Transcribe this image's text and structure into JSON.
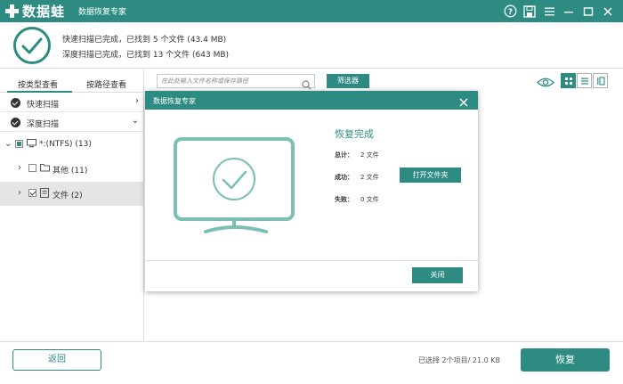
{
  "app": {
    "logo_text": "数据蛙",
    "title": "数据恢复专家"
  },
  "window_icons": [
    "help-icon",
    "save-icon",
    "menu-icon",
    "minimize-icon",
    "maximize-icon",
    "close-icon"
  ],
  "scan_summary": {
    "quick_line": "快速扫描已完成，已找到 5 个文件 (43.4 MB)",
    "deep_line": "深度扫描已完成，已找到 13 个文件 (643 MB)"
  },
  "sidebar": {
    "tabs": [
      {
        "label": "按类型查看",
        "active": true
      },
      {
        "label": "按路径查看",
        "active": false
      }
    ],
    "scan_modes": [
      {
        "label": "快速扫描",
        "arrow": "›"
      },
      {
        "label": "深度扫描",
        "arrow": "⌄"
      }
    ],
    "tree": [
      {
        "expander": "⌄",
        "label": "*:(NTFS) (13)",
        "checkbox": "partial"
      },
      {
        "expander": "›",
        "label": "其他 (11)",
        "checkbox": "unchecked"
      },
      {
        "expander": "›",
        "label": "文件 (2)",
        "checkbox": "checked"
      }
    ]
  },
  "toolbar": {
    "search_placeholder": "在此处输入文件名称或保存路径",
    "filter_label": "筛选器"
  },
  "footer": {
    "back_label": "返回",
    "selection_info": "已选择 2个项目/ 21.0 KB",
    "recover_label": "恢复"
  },
  "dialog": {
    "title": "数据恢复专家",
    "heading": "恢复完成",
    "stats": [
      {
        "label": "总计：",
        "value": "2 文件"
      },
      {
        "label": "成功：",
        "value": "2 文件"
      },
      {
        "label": "失败：",
        "value": "0 文件"
      }
    ],
    "open_folder_label": "打开文件夹",
    "close_label": "关闭"
  },
  "colors": {
    "accent": "#2e8b82",
    "icon_light": "#7bbfb5"
  }
}
